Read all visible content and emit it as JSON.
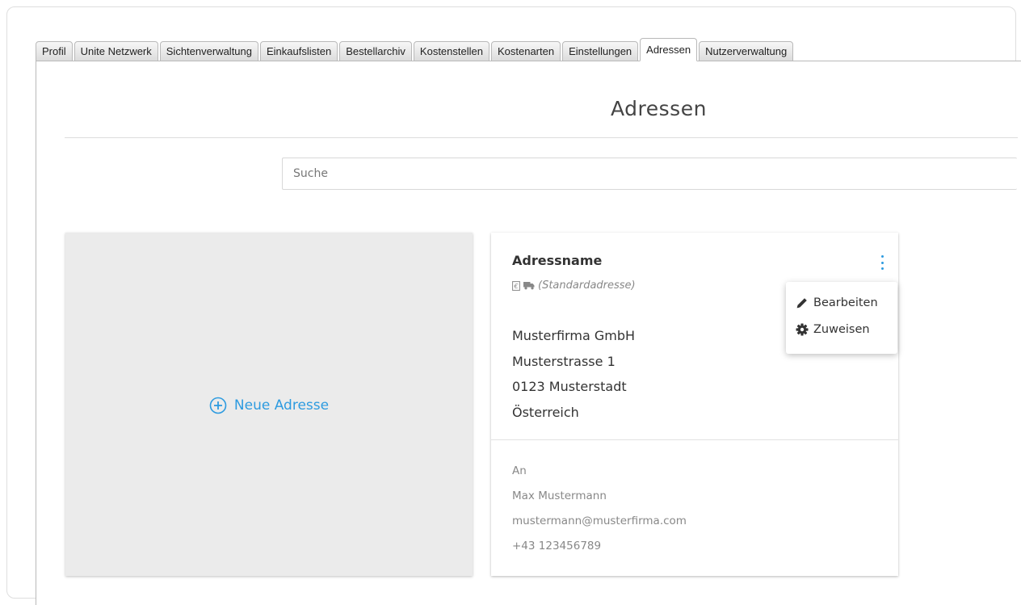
{
  "tabs": [
    {
      "label": "Profil",
      "active": false
    },
    {
      "label": "Unite Netzwerk",
      "active": false
    },
    {
      "label": "Sichtenverwaltung",
      "active": false
    },
    {
      "label": "Einkaufslisten",
      "active": false
    },
    {
      "label": "Bestellarchiv",
      "active": false
    },
    {
      "label": "Kostenstellen",
      "active": false
    },
    {
      "label": "Kostenarten",
      "active": false
    },
    {
      "label": "Einstellungen",
      "active": false
    },
    {
      "label": "Adressen",
      "active": true
    },
    {
      "label": "Nutzerverwaltung",
      "active": false
    }
  ],
  "page": {
    "title": "Adressen"
  },
  "search": {
    "placeholder": "Suche",
    "value": ""
  },
  "new_address": {
    "label": "Neue Adresse",
    "icon": "plus-circle-icon"
  },
  "address_card": {
    "name": "Adressname",
    "badge_icons": [
      "invoice-icon",
      "truck-icon"
    ],
    "default_label": "(Standardadresse)",
    "lines": [
      "Musterfirma GmbH",
      "Musterstrasse 1",
      "0123 Musterstadt",
      "Österreich"
    ],
    "contact": {
      "attention_label": "An",
      "person": "Max Mustermann",
      "email": "mustermann@musterfirma.com",
      "phone": "+43 123456789"
    }
  },
  "context_menu": {
    "items": [
      {
        "label": "Bearbeiten",
        "icon": "pencil-icon"
      },
      {
        "label": "Zuweisen",
        "icon": "gear-icon"
      }
    ]
  },
  "colors": {
    "accent": "#2d9be0",
    "new_card_bg": "#ebebeb",
    "muted_text": "#888888"
  }
}
